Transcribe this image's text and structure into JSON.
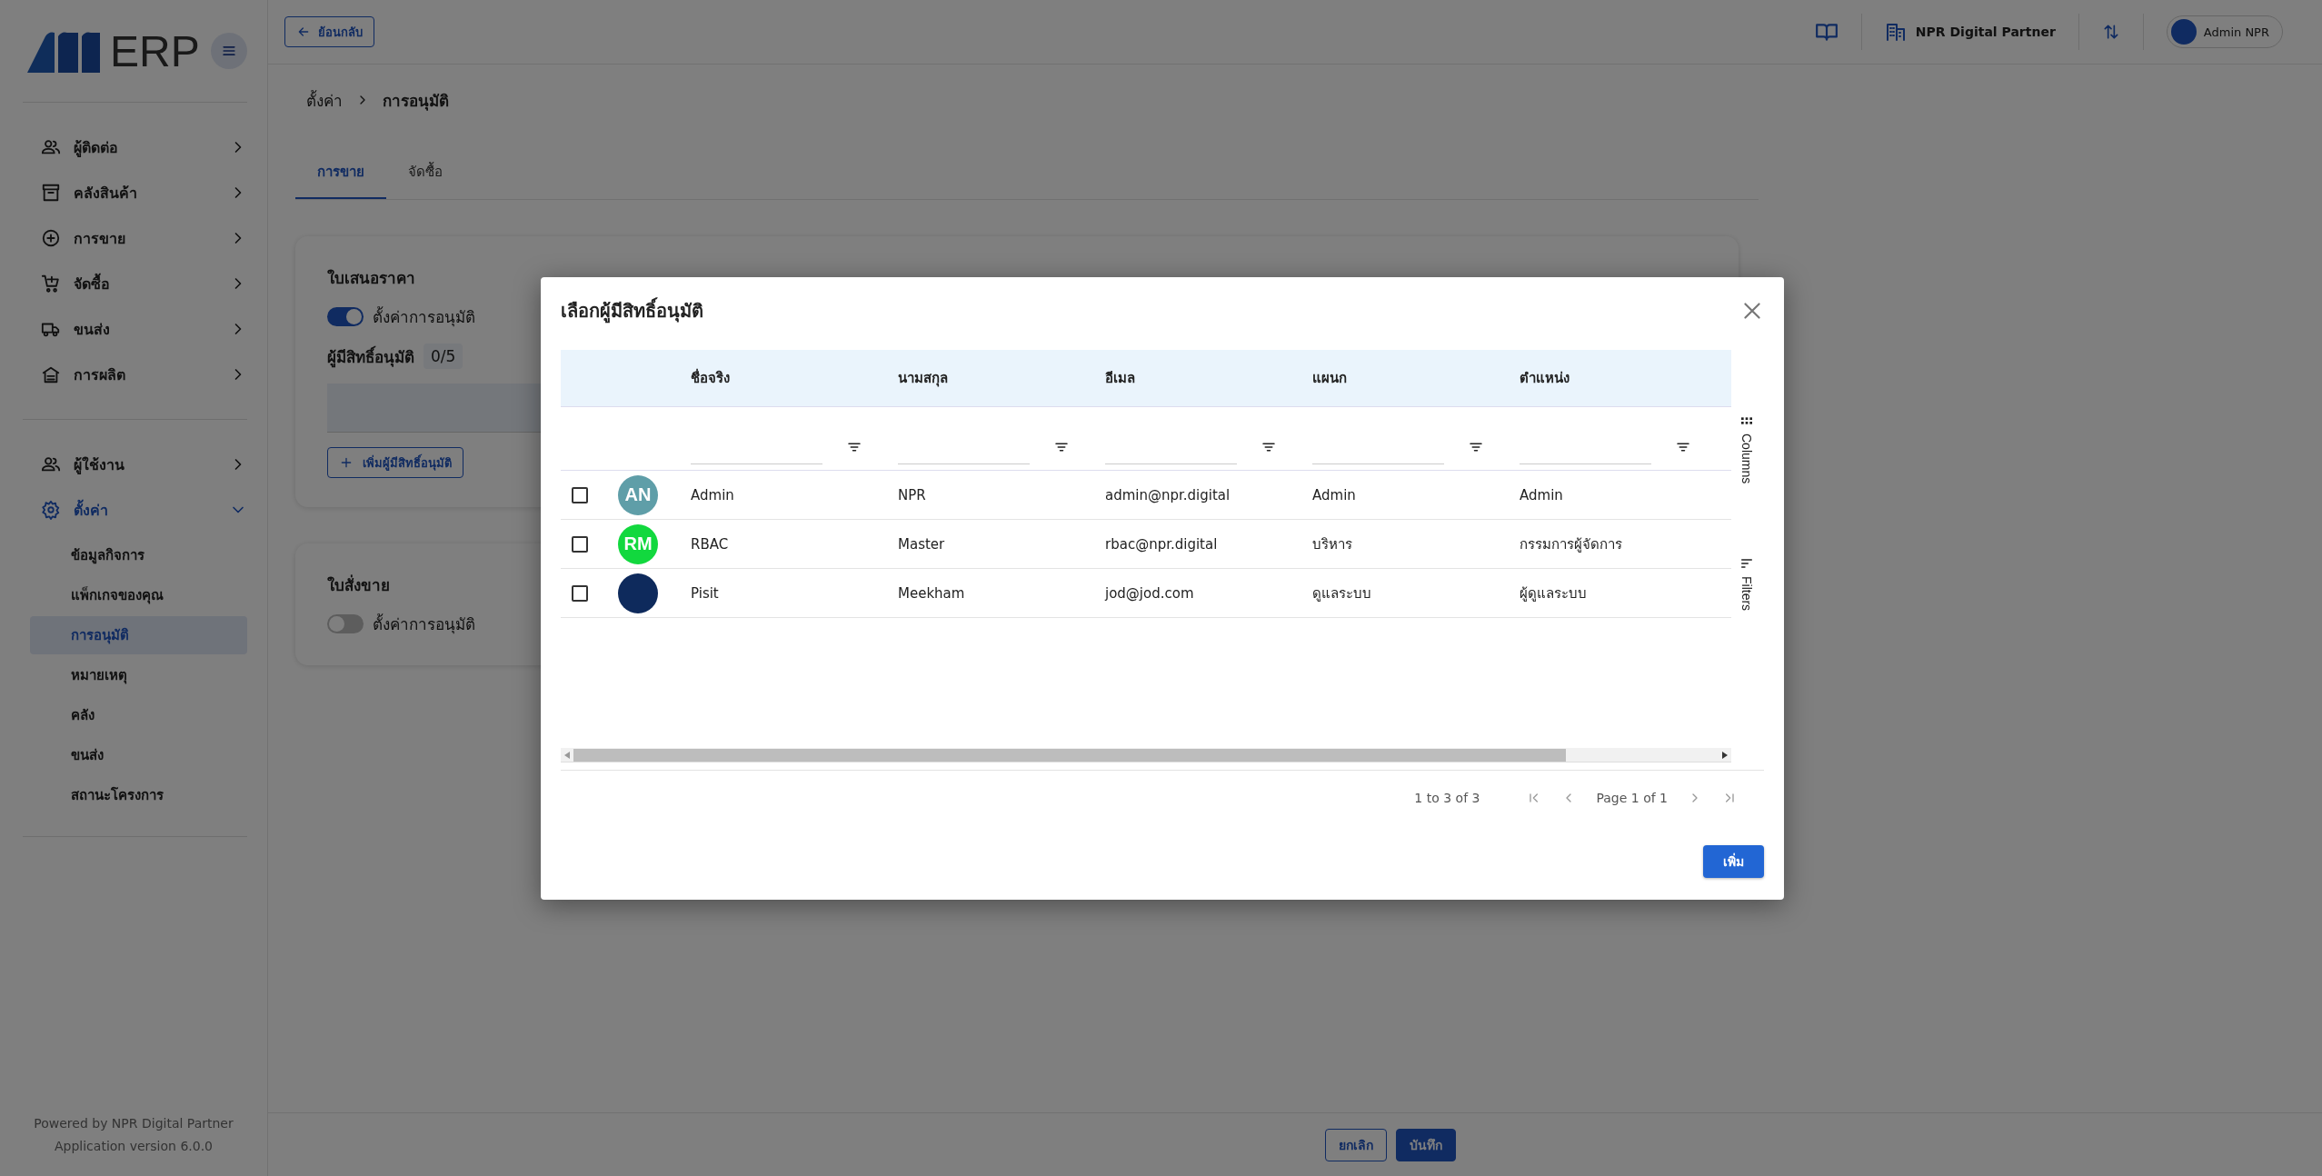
{
  "sidebar": {
    "logo_text": "ERP",
    "sections": [
      [
        {
          "label": "ผู้ติดต่อ",
          "expanded": false
        },
        {
          "label": "คลังสินค้า",
          "expanded": false
        },
        {
          "label": "การขาย",
          "expanded": false
        },
        {
          "label": "จัดซื้อ",
          "expanded": false
        },
        {
          "label": "ขนส่ง",
          "expanded": false
        },
        {
          "label": "การผลิต",
          "expanded": false
        }
      ],
      [
        {
          "label": "ผู้ใช้งาน",
          "expanded": false
        },
        {
          "label": "ตั้งค่า",
          "expanded": true,
          "children": [
            {
              "label": "ข้อมูลกิจการ",
              "selected": false
            },
            {
              "label": "แพ็กเกจของคุณ",
              "selected": false
            },
            {
              "label": "การอนุมัติ",
              "selected": true
            },
            {
              "label": "หมายเหตุ",
              "selected": false
            },
            {
              "label": "คลัง",
              "selected": false
            },
            {
              "label": "ขนส่ง",
              "selected": false
            },
            {
              "label": "สถานะโครงการ",
              "selected": false
            }
          ]
        }
      ]
    ],
    "footer": [
      "Powered by NPR Digital Partner",
      "Application version 6.0.0"
    ]
  },
  "topbar": {
    "back_button": "ย้อนกลับ",
    "company": "NPR Digital Partner",
    "user": "Admin NPR"
  },
  "breadcrumb": [
    "ตั้งค่า",
    "การอนุมัติ"
  ],
  "tabs": [
    {
      "label": "การขาย",
      "selected": true
    },
    {
      "label": "จัดซื้อ",
      "selected": false
    }
  ],
  "cards": [
    {
      "title": "ใบเสนอราคา",
      "toggle": {
        "label": "ตั้งค่าการอนุมัติ",
        "on": true
      },
      "approvers_label": "ผู้มีสิทธิ์อนุมัติ",
      "approvers_count": "0/5",
      "add_button": "เพิ่มผู้มีสิทธิ์อนุมัติ"
    },
    {
      "title": "ใบสั่งขาย",
      "toggle": {
        "label": "ตั้งค่าการอนุมัติ",
        "on": false
      }
    }
  ],
  "modal": {
    "title": "เลือกผู้มีสิทธิ์อนุมัติ",
    "columns": [
      "ชื่อจริง",
      "นามสกุล",
      "อีเมล",
      "แผนก",
      "ตำแหน่ง"
    ],
    "rows": [
      {
        "checked": false,
        "avatar": {
          "kind": "initials",
          "text": "AN",
          "color": "#5f9ea8"
        },
        "cells": [
          "Admin",
          "NPR",
          "admin@npr.digital",
          "Admin",
          "Admin"
        ]
      },
      {
        "checked": false,
        "avatar": {
          "kind": "initials",
          "text": "RM",
          "color": "#12d83e"
        },
        "cells": [
          "RBAC",
          "Master",
          "rbac@npr.digital",
          "บริหาร",
          "กรรมการผู้จัดการ"
        ]
      },
      {
        "checked": false,
        "avatar": {
          "kind": "photo"
        },
        "cells": [
          "Pisit",
          "Meekham",
          "jod@jod.com",
          "ดูแลระบบ",
          "ผู้ดูแลระบบ"
        ]
      }
    ],
    "side_buttons": [
      "Columns",
      "Filters"
    ],
    "pagination": {
      "summary": "1 to 3 of 3",
      "page": "Page 1 of 1"
    },
    "add_button": "เพิ่ม"
  },
  "bottom_buttons": [
    "ยกเลิก",
    "บันทึก"
  ]
}
